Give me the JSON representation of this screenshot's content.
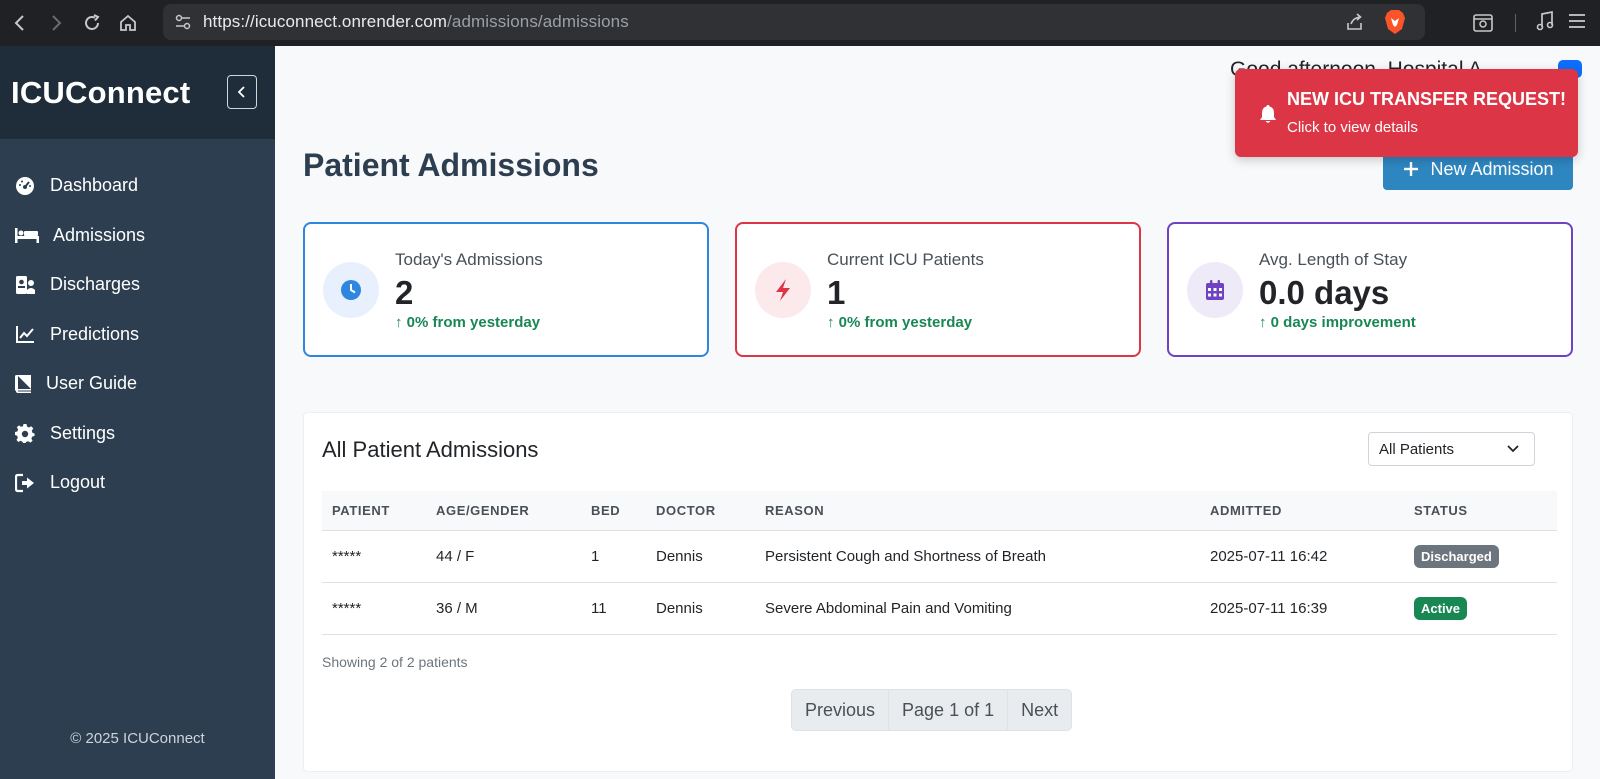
{
  "browser": {
    "url_host": "https://icuconnect.onrender.com",
    "url_path": "/admissions/admissions"
  },
  "sidebar": {
    "brand": "ICUConnect",
    "items": [
      {
        "label": "Dashboard",
        "icon": "gauge-icon"
      },
      {
        "label": "Admissions",
        "icon": "bed-icon"
      },
      {
        "label": "Discharges",
        "icon": "patient-icon"
      },
      {
        "label": "Predictions",
        "icon": "chart-line-icon"
      },
      {
        "label": "User Guide",
        "icon": "book-icon"
      },
      {
        "label": "Settings",
        "icon": "gear-icon"
      },
      {
        "label": "Logout",
        "icon": "logout-icon"
      }
    ],
    "footer": "© 2025 ICUConnect"
  },
  "header": {
    "greeting": "Good afternoon, Hospital A"
  },
  "page": {
    "title": "Patient Admissions",
    "new_button": "New Admission"
  },
  "stats": [
    {
      "label": "Today's Admissions",
      "value": "2",
      "trend": "0% from yesterday",
      "color": "#2e86de",
      "bg": "#e7f0fc",
      "icon": "clock-icon"
    },
    {
      "label": "Current ICU Patients",
      "value": "1",
      "trend": "0% from yesterday",
      "color": "#dc3545",
      "bg": "#fbe9eb",
      "icon": "bolt-icon"
    },
    {
      "label": "Avg. Length of Stay",
      "value": "0.0 days",
      "trend": "0 days improvement",
      "color": "#6f42c1",
      "bg": "#efeaf8",
      "icon": "calendar-icon"
    }
  ],
  "table_card": {
    "title": "All Patient Admissions",
    "filter_value": "All Patients",
    "columns": [
      "PATIENT",
      "AGE/GENDER",
      "BED",
      "DOCTOR",
      "REASON",
      "ADMITTED",
      "STATUS"
    ],
    "rows": [
      {
        "patient": "*****",
        "age_gender": "44 / F",
        "bed": "1",
        "doctor": "Dennis",
        "reason": "Persistent Cough and Shortness of Breath",
        "admitted": "2025-07-11 16:42",
        "status": "Discharged",
        "status_color": "#6c757d"
      },
      {
        "patient": "*****",
        "age_gender": "36 / M",
        "bed": "11",
        "doctor": "Dennis",
        "reason": "Severe Abdominal Pain and Vomiting",
        "admitted": "2025-07-11 16:39",
        "status": "Active",
        "status_color": "#198754"
      }
    ],
    "showing": "Showing 2 of 2 patients",
    "pager": {
      "prev": "Previous",
      "page": "Page 1 of 1",
      "next": "Next"
    }
  },
  "toast": {
    "title": "NEW ICU TRANSFER REQUEST!",
    "subtitle": "Click to view details",
    "color": "#dc3545"
  }
}
